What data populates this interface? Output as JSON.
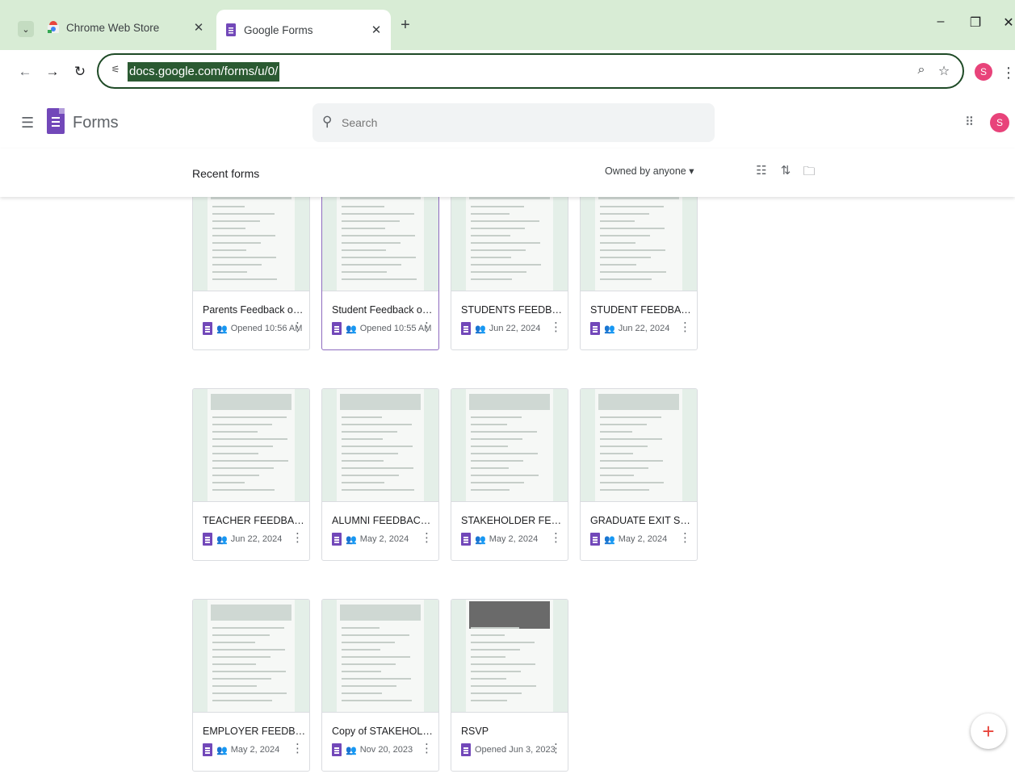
{
  "browser": {
    "tabs": [
      {
        "title": "Chrome Web Store",
        "active": false
      },
      {
        "title": "Google Forms",
        "active": true
      }
    ],
    "new_tab": "+",
    "url": "docs.google.com/forms/u/0/",
    "profile_initial": "S"
  },
  "app": {
    "title": "Forms",
    "search_placeholder": "Search",
    "profile_initial": "S"
  },
  "list": {
    "heading": "Recent forms",
    "owner_filter": "Owned by anyone ▾"
  },
  "forms": [
    {
      "name": "Parents Feedback on Cur...",
      "meta": "Opened 10:56 AM",
      "shared": true,
      "photo": false
    },
    {
      "name": "Student Feedback on Infr...",
      "meta": "Opened 10:55 AM",
      "shared": true,
      "photo": false
    },
    {
      "name": "STUDENTS FEEDBACK FO...",
      "meta": "Jun 22, 2024",
      "shared": true,
      "photo": false
    },
    {
      "name": "STUDENT FEEDBACK ON ...",
      "meta": "Jun 22, 2024",
      "shared": true,
      "photo": false
    },
    {
      "name": "TEACHER FEEDBACK ON ...",
      "meta": "Jun 22, 2024",
      "shared": true,
      "photo": false
    },
    {
      "name": "ALUMNI FEEDBACK FORM",
      "meta": "May 2, 2024",
      "shared": true,
      "photo": false
    },
    {
      "name": "STAKEHOLDER FEEDBAC...",
      "meta": "May 2, 2024",
      "shared": true,
      "photo": false
    },
    {
      "name": "GRADUATE EXIT SURVEY",
      "meta": "May 2, 2024",
      "shared": true,
      "photo": false
    },
    {
      "name": "EMPLOYER FEEDBACK F...",
      "meta": "May 2, 2024",
      "shared": true,
      "photo": false
    },
    {
      "name": "Copy of STAKEHOLDER F...",
      "meta": "Nov 20, 2023",
      "shared": true,
      "photo": false
    },
    {
      "name": "RSVP",
      "meta": "Opened Jun 3, 2023",
      "shared": false,
      "photo": true
    }
  ],
  "fab_label": "+"
}
